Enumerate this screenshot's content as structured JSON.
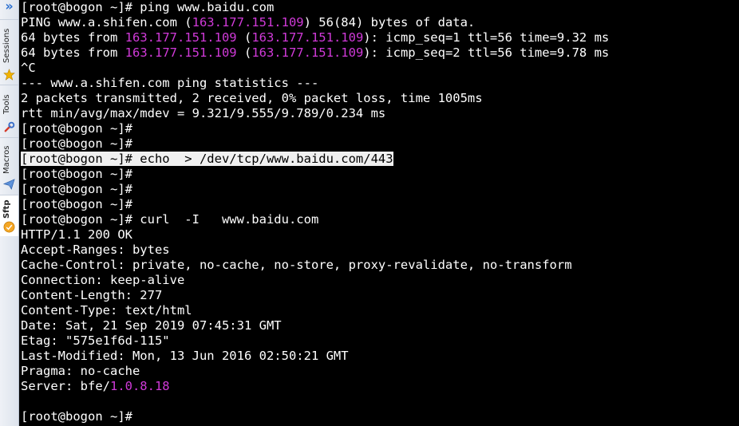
{
  "sidebar": {
    "collapse_glyph": "»",
    "tabs": [
      {
        "label": "Sessions",
        "icon": "star-icon"
      },
      {
        "label": "Tools",
        "icon": "wrench-icon"
      },
      {
        "label": "Macros",
        "icon": "paper-plane-icon"
      },
      {
        "label": "Sftp",
        "icon": "sftp-icon"
      }
    ]
  },
  "colors": {
    "background": "#000000",
    "foreground": "#ffffff",
    "ip_highlight": "#d03ad8",
    "selection": "#f0f0f0"
  },
  "terminal": {
    "lines": [
      [
        {
          "t": "[root@bogon ~]# ping www.baidu.com"
        }
      ],
      [
        {
          "t": "PING www.a.shifen.com ("
        },
        {
          "t": "163.177.151.109",
          "c": "ip"
        },
        {
          "t": ") 56(84) bytes of data."
        }
      ],
      [
        {
          "t": "64 bytes from "
        },
        {
          "t": "163.177.151.109",
          "c": "ip"
        },
        {
          "t": " ("
        },
        {
          "t": "163.177.151.109",
          "c": "ip"
        },
        {
          "t": "): icmp_seq=1 ttl=56 time=9.32 ms"
        }
      ],
      [
        {
          "t": "64 bytes from "
        },
        {
          "t": "163.177.151.109",
          "c": "ip"
        },
        {
          "t": " ("
        },
        {
          "t": "163.177.151.109",
          "c": "ip"
        },
        {
          "t": "): icmp_seq=2 ttl=56 time=9.78 ms"
        }
      ],
      [
        {
          "t": "^C"
        }
      ],
      [
        {
          "t": "--- www.a.shifen.com ping statistics ---"
        }
      ],
      [
        {
          "t": "2 packets transmitted, 2 received, 0% packet loss, time 1005ms"
        }
      ],
      [
        {
          "t": "rtt min/avg/max/mdev = 9.321/9.555/9.789/0.234 ms"
        }
      ],
      [
        {
          "t": "[root@bogon ~]#"
        }
      ],
      [
        {
          "t": "[root@bogon ~]#"
        }
      ],
      [
        {
          "t": "[root@bogon ~]# echo  > /dev/tcp/www.baidu.com/443",
          "c": "sel"
        }
      ],
      [
        {
          "t": "[root@bogon ~]#"
        }
      ],
      [
        {
          "t": "[root@bogon ~]#"
        }
      ],
      [
        {
          "t": "[root@bogon ~]#"
        }
      ],
      [
        {
          "t": "[root@bogon ~]# curl  -I   www.baidu.com"
        }
      ],
      [
        {
          "t": "HTTP/1.1 200 OK"
        }
      ],
      [
        {
          "t": "Accept-Ranges: bytes"
        }
      ],
      [
        {
          "t": "Cache-Control: private, no-cache, no-store, proxy-revalidate, no-transform"
        }
      ],
      [
        {
          "t": "Connection: keep-alive"
        }
      ],
      [
        {
          "t": "Content-Length: 277"
        }
      ],
      [
        {
          "t": "Content-Type: text/html"
        }
      ],
      [
        {
          "t": "Date: Sat, 21 Sep 2019 07:45:31 GMT"
        }
      ],
      [
        {
          "t": "Etag: \"575e1f6d-115\""
        }
      ],
      [
        {
          "t": "Last-Modified: Mon, 13 Jun 2016 02:50:21 GMT"
        }
      ],
      [
        {
          "t": "Pragma: no-cache"
        }
      ],
      [
        {
          "t": "Server: bfe/"
        },
        {
          "t": "1.0.8.18",
          "c": "ip"
        }
      ],
      [
        {
          "t": ""
        }
      ],
      [
        {
          "t": "[root@bogon ~]#"
        }
      ]
    ]
  }
}
